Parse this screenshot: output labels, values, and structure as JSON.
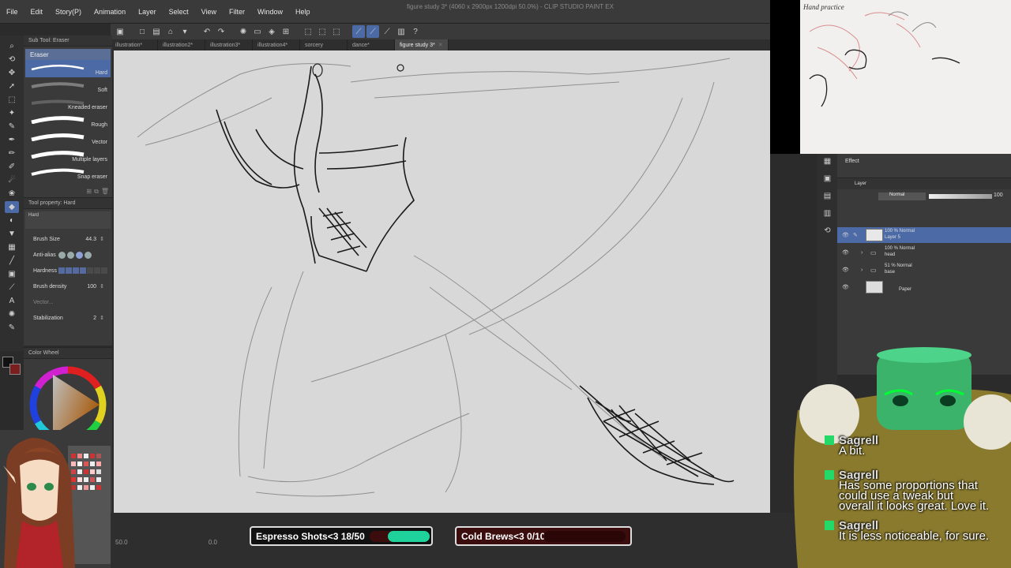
{
  "window": {
    "title": "figure study 3* (4060 x 2900px 1200dpi 50.0%) - CLIP STUDIO PAINT EX"
  },
  "menu": [
    "File",
    "Edit",
    "Story(P)",
    "Animation",
    "Layer",
    "Select",
    "View",
    "Filter",
    "Window",
    "Help"
  ],
  "tabs": [
    {
      "label": "illustration*"
    },
    {
      "label": "illustration2*"
    },
    {
      "label": "illustration3*"
    },
    {
      "label": "illustration4*"
    },
    {
      "label": "sorcery"
    },
    {
      "label": "dance*"
    },
    {
      "label": "figure study 3*",
      "active": true
    }
  ],
  "subtool": {
    "panel_title": "Sub Tool: Eraser",
    "group": "Eraser",
    "brushes": [
      "Hard",
      "Soft",
      "Kneaded eraser",
      "Rough",
      "Vector",
      "Multiple layers",
      "Snap eraser"
    ],
    "selected": "Hard"
  },
  "tool_property": {
    "panel_title": "Tool property: Hard",
    "preset": "Hard",
    "brush_size_label": "Brush Size",
    "brush_size": "44.3",
    "anti_alias_label": "Anti-alias",
    "hardness_label": "Hardness",
    "brush_density_label": "Brush density",
    "brush_density": "100",
    "vector_label": "Vector...",
    "stabilization_label": "Stabilization",
    "stabilization": "2"
  },
  "color_wheel": {
    "panel_title": "Color Wheel"
  },
  "layer_panel": {
    "effect_label": "Effect",
    "tab_label": "Layer",
    "blend_mode": "Normal",
    "opacity": "100",
    "layers": [
      {
        "line1": "100 % Normal",
        "line2": "Layer 5",
        "selected": true
      },
      {
        "line1": "100 % Normal",
        "line2": "head"
      },
      {
        "line1": "51 % Normal",
        "line2": "base"
      },
      {
        "line1": "",
        "line2": "Paper"
      }
    ]
  },
  "status": {
    "zoom": "50.0",
    "angle": "0.0"
  },
  "goals": [
    {
      "label": "Espresso Shots<3 18/50",
      "progress": 0.36,
      "color": "#1fd19a"
    },
    {
      "label": "Cold Brews<3 0/10",
      "progress": 0.0,
      "color": "#c81d1d"
    }
  ],
  "chat": [
    {
      "user": "Sagrell",
      "text": "A bit."
    },
    {
      "user": "Sagrell",
      "text_lines": [
        "Has some proportions that",
        "could use a tweak but",
        "overall it looks great. Love it."
      ]
    },
    {
      "user": "Sagrell",
      "text": "It is less noticeable, for sure."
    }
  ],
  "reference": {
    "title": "Hand practice"
  },
  "colors": {
    "accent": "#4b6aa6",
    "panel": "#3a3a3a",
    "canvas": "#d8d8d8"
  }
}
